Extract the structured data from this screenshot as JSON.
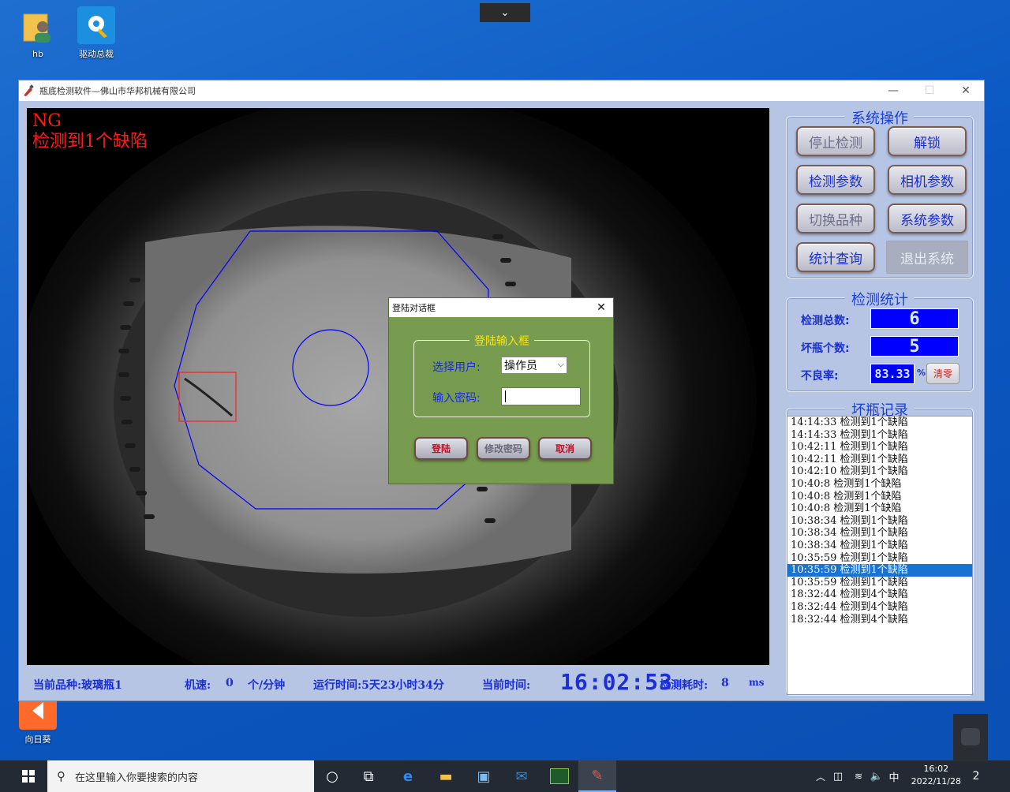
{
  "desktop": {
    "icons": [
      {
        "label": "hb",
        "icon": "user-folder-icon"
      },
      {
        "label": "驱动总裁",
        "icon": "driver-tool-icon"
      },
      {
        "label": "向日葵",
        "icon": "sunflower-remote-icon"
      }
    ]
  },
  "window": {
    "title": "瓶底检测软件—佛山市华邦机械有限公司",
    "controls": {
      "minimize": "—",
      "maximize": "☐",
      "close": "✕"
    }
  },
  "camera": {
    "ng_label": "NG",
    "defect_text": "检测到1个缺陷"
  },
  "system_ops": {
    "title": "系统操作",
    "buttons": [
      "停止检测",
      "解锁",
      "检测参数",
      "相机参数",
      "切换品种",
      "系统参数",
      "统计查询",
      "退出系统"
    ]
  },
  "stats": {
    "title": "检测统计",
    "total_label": "检测总数:",
    "total_value": "6",
    "bad_label": "坏瓶个数:",
    "bad_value": "5",
    "rate_label": "不良率:",
    "rate_value": "83.33",
    "rate_unit": "%",
    "clear_label": "清零"
  },
  "records": {
    "title": "坏瓶记录",
    "rows": [
      "14:14:33  检测到1个缺陷",
      "14:14:33  检测到1个缺陷",
      "10:42:11  检测到1个缺陷",
      "10:42:11  检测到1个缺陷",
      "10:42:10  检测到1个缺陷",
      "10:40:8  检测到1个缺陷",
      "10:40:8  检测到1个缺陷",
      "10:40:8  检测到1个缺陷",
      "10:38:34  检测到1个缺陷",
      "10:38:34  检测到1个缺陷",
      "10:38:34  检测到1个缺陷",
      "10:35:59  检测到1个缺陷",
      "10:35:59  检测到1个缺陷",
      "10:35:59  检测到1个缺陷",
      "18:32:44  检测到4个缺陷",
      "18:32:44  检测到4个缺陷",
      "18:32:44  检测到4个缺陷"
    ],
    "selected_index": 12
  },
  "status_bar": {
    "product": "当前品种:玻璃瓶1",
    "speed_label": "机速:",
    "speed_value": "0",
    "speed_unit": "个/分钟",
    "runtime": "运行时间:5天23小时34分",
    "current_time_label": "当前时间:",
    "current_time": "16:02:53",
    "elapsed_label": "检测耗时:",
    "elapsed_value": "8",
    "elapsed_unit": "ms"
  },
  "login_dialog": {
    "title": "登陆对话框",
    "group_title": "登陆输入框",
    "user_label": "选择用户:",
    "user_value": "操作员",
    "password_label": "输入密码:",
    "password_value": "",
    "login_button": "登陆",
    "change_password_button": "修改密码",
    "cancel_button": "取消"
  },
  "taskbar": {
    "search_placeholder": "在这里输入你要搜索的内容",
    "time": "16:02",
    "date": "2022/11/28",
    "ime": "中",
    "notification_count": "2"
  },
  "colors": {
    "accent_blue": "#1a2fd6",
    "ng_red": "#ff1a1a",
    "dialog_green": "#779b4f",
    "lcd_blue": "#0000ff",
    "panel_bg": "#b7c5e4"
  }
}
